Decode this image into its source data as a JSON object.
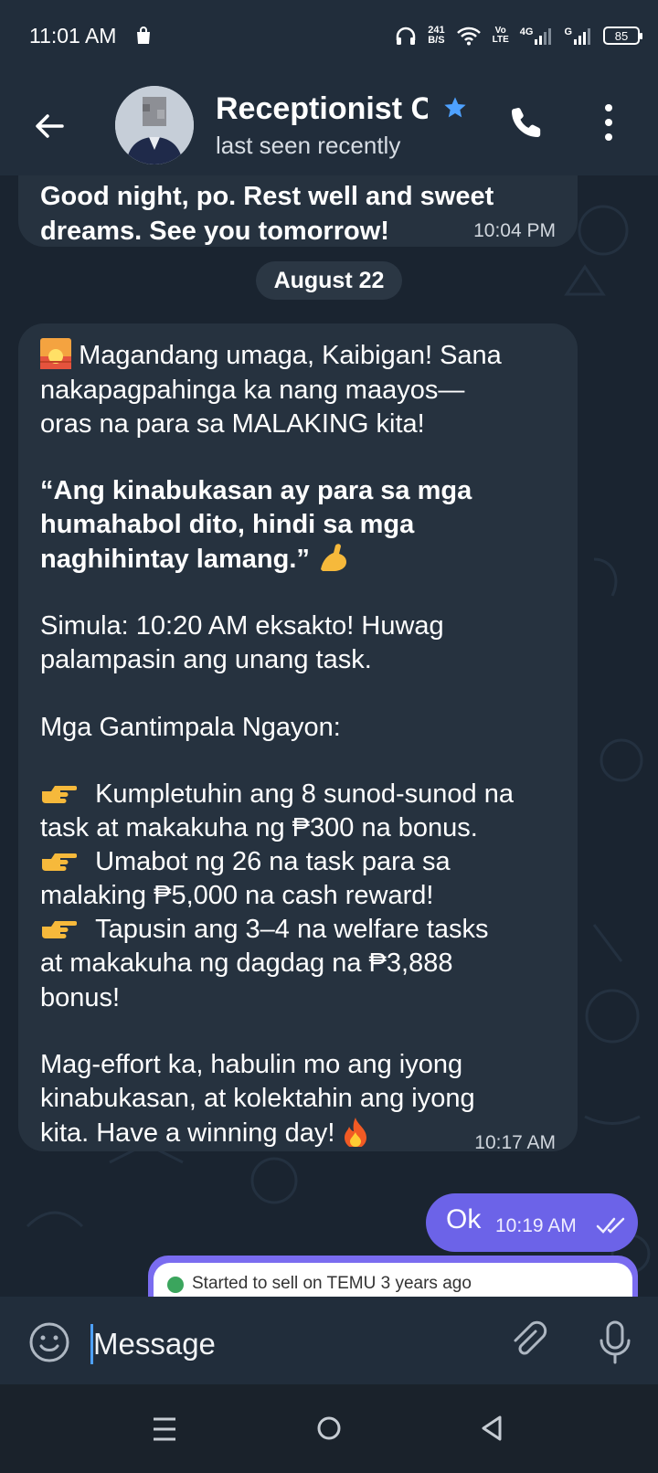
{
  "status_bar": {
    "time": "11:01 AM",
    "net_speed_value": "241",
    "net_speed_unit": "B/S",
    "volte_line1": "Vo",
    "volte_line2": "LTE",
    "network_1": "4G",
    "network_2": "G",
    "battery": "85",
    "icons": [
      "shop-bag-icon",
      "headphones-icon",
      "wifi-icon",
      "signal-icon",
      "battery-icon"
    ]
  },
  "header": {
    "title": "Receptionist C",
    "status": "last seen recently",
    "icons": [
      "back-arrow-icon",
      "star-icon",
      "phone-icon",
      "more-vertical-icon"
    ]
  },
  "messages": {
    "previous": {
      "line1": "Good night, po. Rest well and sweet",
      "line2": "dreams. See you tomorrow!",
      "time": "10:04 PM"
    },
    "date_separator": "August 22",
    "main": {
      "line1": "Magandang umaga, Kaibigan! Sana",
      "line2": "nakapagpahinga ka nang maayos—",
      "line3": "oras na para sa MALAKING kita!",
      "quote1": "“Ang kinabukasan ay para sa mga",
      "quote2": "humahabol dito, hindi sa mga",
      "quote3": "naghihintay lamang.”",
      "start1": "Simula: 10:20 AM eksakto! Huwag",
      "start2": "palampasin ang unang task.",
      "rewards_heading": "Mga Gantimpala Ngayon:",
      "reward1a": "Kumpletuhin ang 8 sunod-sunod na",
      "reward1b": "task at makakuha ng ₱300 na bonus.",
      "reward2a": "Umabot ng 26 na task para sa",
      "reward2b": "malaking ₱5,000 na cash reward!",
      "reward3a": "Tapusin ang 3–4 na welfare tasks",
      "reward3b": "at makakuha ng dagdag na ₱3,888",
      "reward3c": "bonus!",
      "closing1": "Mag-effort ka, habulin mo ang iyong",
      "closing2": "kinabukasan, at kolektahin ang iyong",
      "closing3": "kita. Have a winning day!",
      "time": "10:17 AM"
    },
    "outgoing": {
      "text": "Ok",
      "time": "10:19 AM"
    },
    "card_preview": {
      "text": "Started to sell on TEMU 3 years ago"
    }
  },
  "input": {
    "placeholder": "Message",
    "icons": [
      "emoji-icon",
      "attach-icon",
      "mic-icon"
    ]
  },
  "colors": {
    "header_bg": "#212d3b",
    "chat_bg": "#1a2430",
    "incoming_bubble": "#26323f",
    "outgoing_bubble": "#6c63e8",
    "accent_blue": "#4ea1ff"
  }
}
